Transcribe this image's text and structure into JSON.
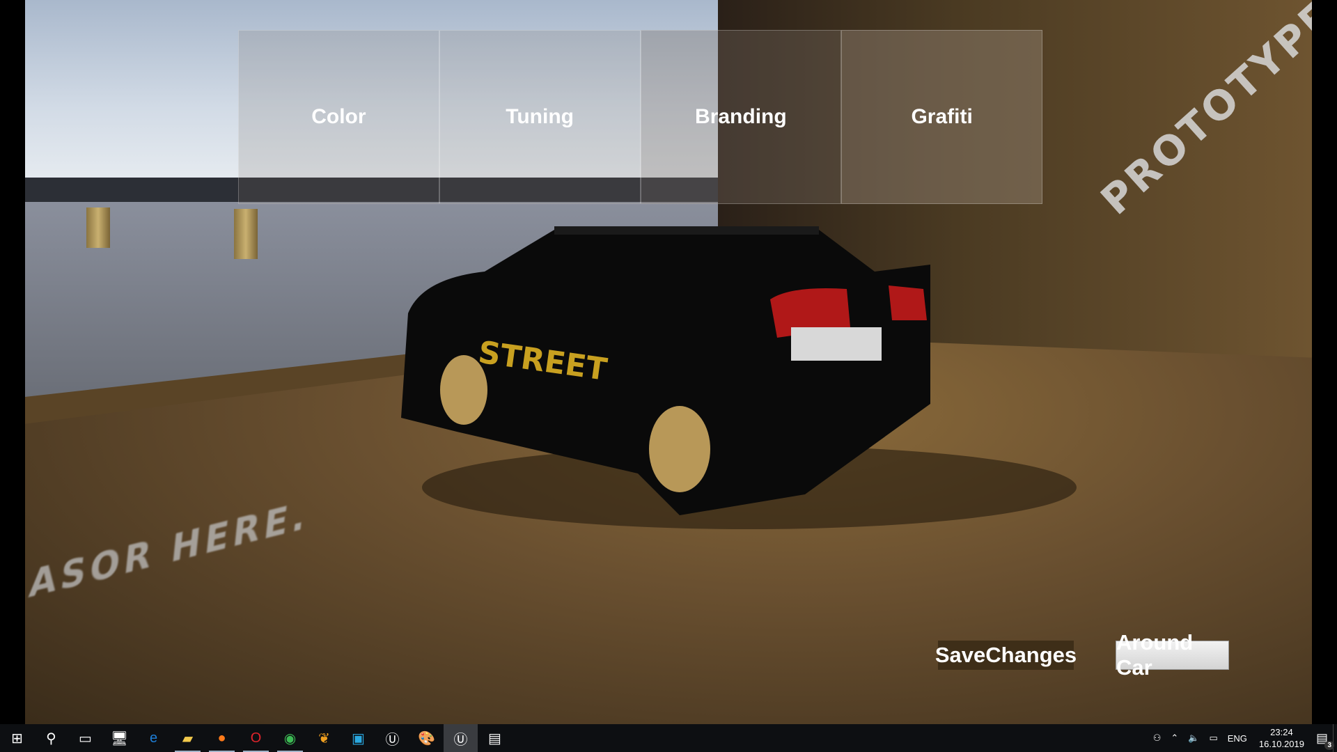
{
  "menu": {
    "tabs": [
      {
        "label": "Color"
      },
      {
        "label": "Tuning"
      },
      {
        "label": "Branding"
      },
      {
        "label": "Grafiti"
      }
    ]
  },
  "actions": {
    "save_label": "SaveChanges",
    "around_label": "Around Car"
  },
  "scene": {
    "wall_text": "PROTOTYPE",
    "floor_text": "ASOR HERE."
  },
  "taskbar": {
    "apps": [
      {
        "name": "start-icon",
        "glyph": "⊞",
        "active": false
      },
      {
        "name": "search-icon",
        "glyph": "⚲",
        "active": false
      },
      {
        "name": "task-view-icon",
        "glyph": "▭",
        "active": false
      },
      {
        "name": "this-pc-icon",
        "glyph": "🖥",
        "active": false
      },
      {
        "name": "edge-icon",
        "glyph": "e",
        "color": "#1e7fd8",
        "active": false
      },
      {
        "name": "file-explorer-icon",
        "glyph": "▰",
        "color": "#f2c94c",
        "active": true
      },
      {
        "name": "firefox-icon",
        "glyph": "●",
        "color": "#ff7a1a",
        "active": true
      },
      {
        "name": "opera-icon",
        "glyph": "O",
        "color": "#e0242c",
        "active": true
      },
      {
        "name": "chrome-icon",
        "glyph": "◉",
        "color": "#3cba54",
        "active": true
      },
      {
        "name": "fl-studio-icon",
        "glyph": "❦",
        "color": "#f0a020",
        "active": false
      },
      {
        "name": "video-editor-icon",
        "glyph": "▣",
        "color": "#2aa8e0",
        "active": false
      },
      {
        "name": "unreal-engine-icon",
        "glyph": "Ⓤ",
        "active": false
      },
      {
        "name": "paint-icon",
        "glyph": "🎨",
        "active": false
      },
      {
        "name": "unreal-engine-icon",
        "glyph": "Ⓤ",
        "active": false,
        "selected": true
      },
      {
        "name": "resource-monitor-icon",
        "glyph": "▤",
        "active": false
      }
    ],
    "tray": {
      "language": "ENG",
      "time": "23:24",
      "date": "16.10.2019",
      "notifications": "3"
    }
  }
}
